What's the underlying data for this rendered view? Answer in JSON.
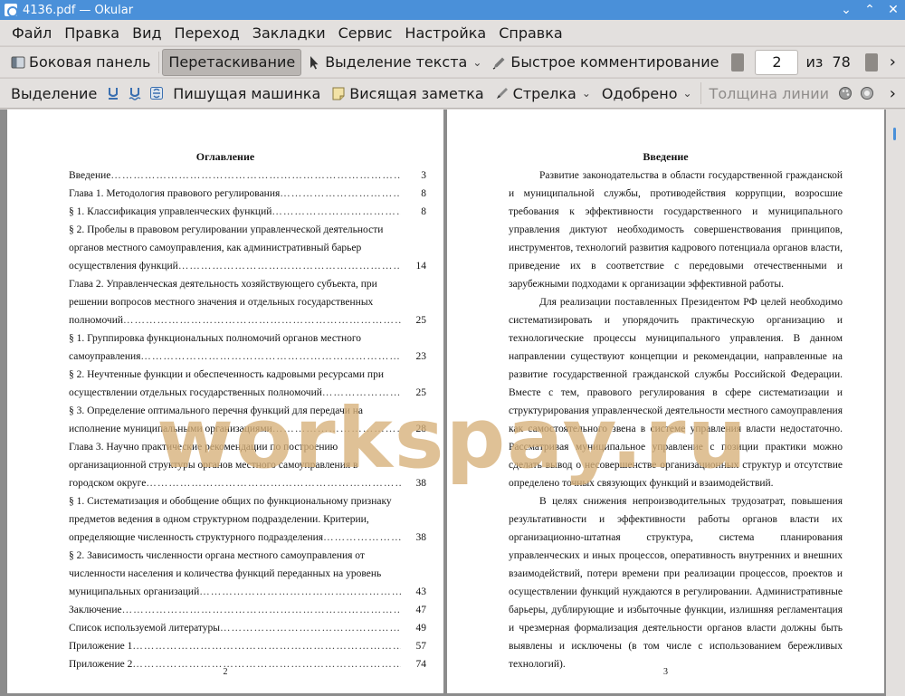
{
  "window": {
    "title": "4136.pdf  — Okular",
    "minimize_glyph": "⌄",
    "maximize_glyph": "⌃",
    "close_glyph": "✕"
  },
  "menu": [
    "Файл",
    "Правка",
    "Вид",
    "Переход",
    "Закладки",
    "Сервис",
    "Настройка",
    "Справка"
  ],
  "toolbar1": {
    "sidebar_label": "Боковая панель",
    "drag_label": "Перетаскивание",
    "text_select_label": "Выделение текста",
    "quick_comment_label": "Быстрое комментирование",
    "page_current": "2",
    "page_of": "из",
    "page_total": "78",
    "more_glyph": "›"
  },
  "toolbar2": {
    "selection_label": "Выделение",
    "typewriter_label": "Пишущая машинка",
    "sticky_note_label": "Висящая заметка",
    "arrow_label": "Стрелка",
    "stamp_label": "Одобрено",
    "line_width_label": "Толщина линии",
    "more_glyph": "›"
  },
  "left_page": {
    "heading": "Оглавление",
    "page_number": "2",
    "toc": [
      {
        "text": "Введение",
        "page": "3",
        "dots": true
      },
      {
        "text": "Глава 1. Методология правового регулирования",
        "page": "8",
        "dots": true
      },
      {
        "text": "§ 1. Классификация управленческих функций",
        "page": "8",
        "dots": true
      },
      {
        "text": "§ 2. Пробелы в правовом регулировании управленческой деятельности",
        "page": "",
        "dots": false
      },
      {
        "text": "органов местного самоуправления, как административный барьер",
        "page": "",
        "dots": false
      },
      {
        "text": "осуществления функций",
        "page": "14",
        "dots": true
      },
      {
        "text": "Глава 2. Управленческая деятельность хозяйствующего субъекта, при",
        "page": "",
        "dots": false
      },
      {
        "text": "решении вопросов местного значения и отдельных государственных",
        "page": "",
        "dots": false
      },
      {
        "text": "полномочий",
        "page": "25",
        "dots": true
      },
      {
        "text": "§ 1. Группировка функциональных полномочий органов местного",
        "page": "",
        "dots": false
      },
      {
        "text": "самоуправления",
        "page": "23",
        "dots": true
      },
      {
        "text": "§ 2. Неучтенные функции и обеспеченность кадровыми ресурсами при",
        "page": "",
        "dots": false
      },
      {
        "text": "осуществлении отдельных государственных полномочий",
        "page": "25",
        "dots": true
      },
      {
        "text": "§ 3. Определение оптимального перечня функций для передачи на",
        "page": "",
        "dots": false
      },
      {
        "text": "исполнение муниципальными организациями",
        "page": "28",
        "dots": true
      },
      {
        "text": "Глава 3. Научно практические рекомендации по построению",
        "page": "",
        "dots": false
      },
      {
        "text": "организационной структуры органов местного самоуправления в",
        "page": "",
        "dots": false
      },
      {
        "text": "городском округе",
        "page": "38",
        "dots": true
      },
      {
        "text": "§ 1. Систематизация и обобщение общих по функциональному признаку",
        "page": "",
        "dots": false
      },
      {
        "text": "предметов ведения в одном структурном подразделении. Критерии,",
        "page": "",
        "dots": false
      },
      {
        "text": "определяющие численность структурного подразделения",
        "page": "38",
        "dots": true
      },
      {
        "text": "§ 2. Зависимость численности органа местного самоуправления от",
        "page": "",
        "dots": false
      },
      {
        "text": "численности населения и количества функций переданных на уровень",
        "page": "",
        "dots": false
      },
      {
        "text": "муниципальных организаций",
        "page": "43",
        "dots": true
      },
      {
        "text": "Заключение",
        "page": "47",
        "dots": true
      },
      {
        "text": "Список используемой литературы",
        "page": "49",
        "dots": true
      },
      {
        "text": "Приложение 1",
        "page": "57",
        "dots": true
      },
      {
        "text": "Приложение 2",
        "page": "74",
        "dots": true
      }
    ]
  },
  "right_page": {
    "heading": "Введение",
    "page_number": "3",
    "paragraphs": [
      "Развитие законодательства в области государственной гражданской и муниципальной службы, противодействия коррупции, возросшие требования к эффективности государственного и муниципального управления диктуют необходимость совершенствования принципов, инструментов, технологий развития кадрового потенциала органов власти, приведение их в соответствие с передовыми отечественными и зарубежными подходами к организации эффективной работы.",
      "Для реализации поставленных Президентом РФ целей необходимо систематизировать и упорядочить практическую организацию и технологические процессы муниципального управления. В данном направлении существуют концепции и рекомендации, направленные на развитие государственной гражданской службы Российской Федерации. Вместе с тем, правового регулирования в сфере систематизации и структурирования управленческой деятельности местного самоуправления как самостоятельного звена в системе управления власти недостаточно. Рассматривая муниципальное управление с позиции практики можно сделать вывод о несовершенстве организационных структур и отсутствие определено точных связующих функций и взаимодействий.",
      "В целях снижения непроизводительных трудозатрат, повышения результативности и эффективности работы органов власти их организационно-штатная структура, система планирования управленческих и иных процессов, оперативность внутренних и внешних взаимодействий, потери времени при реализации процессов, проектов и осуществлении функций нуждаются в регулировании. Административные барьеры, дублирующие и избыточные функции, излишняя регламентация и чрезмерная формализация деятельности органов власти должны быть выявлены и исключены (в том числе с использованием бережливых технологий)."
    ]
  },
  "watermark": "workspay.ru",
  "colors": {
    "titlebar": "#4a90d9",
    "toolbar": "#e3e0de",
    "view_background": "#8c8c8c",
    "watermark": "#d6b078"
  }
}
